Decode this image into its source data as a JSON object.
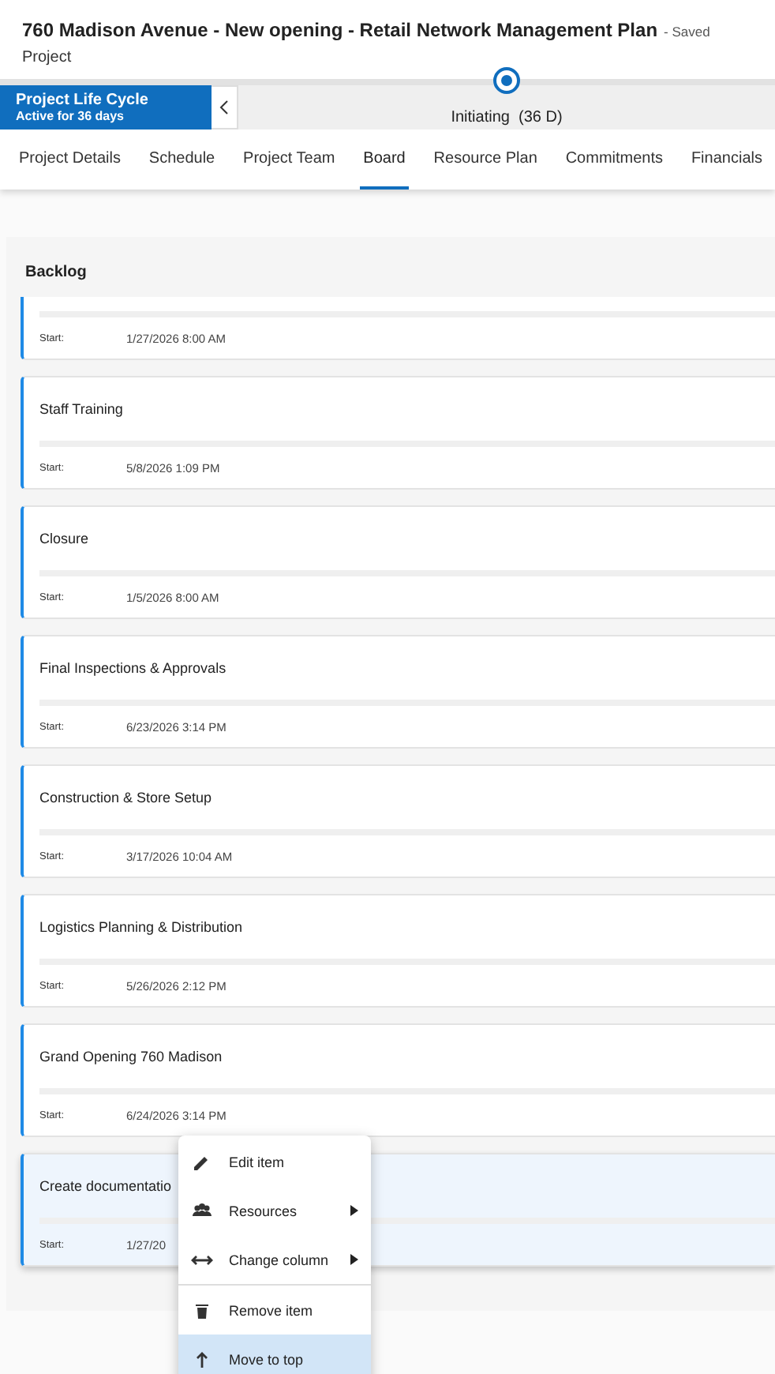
{
  "header": {
    "title": "760 Madison Avenue - New opening - Retail Network Management Plan",
    "status": "- Saved",
    "entity": "Project"
  },
  "lifecycle": {
    "title": "Project Life Cycle",
    "subtitle": "Active for 36 days",
    "stage": "Initiating  (36 D)"
  },
  "tabs": [
    {
      "label": "Project Details",
      "selected": false
    },
    {
      "label": "Schedule",
      "selected": false
    },
    {
      "label": "Project Team",
      "selected": false
    },
    {
      "label": "Board",
      "selected": true
    },
    {
      "label": "Resource Plan",
      "selected": false
    },
    {
      "label": "Commitments",
      "selected": false
    },
    {
      "label": "Financials",
      "selected": false
    }
  ],
  "board": {
    "column": "Backlog",
    "cards": [
      {
        "start_label": "Start:",
        "start": "1/27/2026 8:00 AM",
        "selected": false
      },
      {
        "title": "Staff Training",
        "start_label": "Start:",
        "start": "5/8/2026 1:09 PM",
        "selected": false
      },
      {
        "title": "Closure",
        "start_label": "Start:",
        "start": "1/5/2026 8:00 AM",
        "selected": false
      },
      {
        "title": "Final Inspections & Approvals",
        "start_label": "Start:",
        "start": "6/23/2026 3:14 PM",
        "selected": false
      },
      {
        "title": "Construction & Store Setup",
        "start_label": "Start:",
        "start": "3/17/2026 10:04 AM",
        "selected": false
      },
      {
        "title": "Logistics Planning & Distribution",
        "start_label": "Start:",
        "start": "5/26/2026 2:12 PM",
        "selected": false
      },
      {
        "title": "Grand Opening 760 Madison",
        "start_label": "Start:",
        "start": "6/24/2026 3:14 PM",
        "selected": false
      },
      {
        "title": "Create documentatio",
        "start_label": "Start:",
        "start": "1/27/20",
        "selected": true
      }
    ]
  },
  "context_menu": {
    "items": [
      {
        "kind": "edit",
        "label": "Edit item",
        "submenu": false,
        "selected": false
      },
      {
        "kind": "people",
        "label": "Resources",
        "submenu": true,
        "selected": false
      },
      {
        "kind": "swap",
        "label": "Change column",
        "submenu": true,
        "selected": false
      },
      {
        "kind": "trash",
        "label": "Remove item",
        "submenu": false,
        "selected": false,
        "divider": true
      },
      {
        "kind": "up",
        "label": "Move to top",
        "submenu": false,
        "selected": true
      }
    ]
  }
}
